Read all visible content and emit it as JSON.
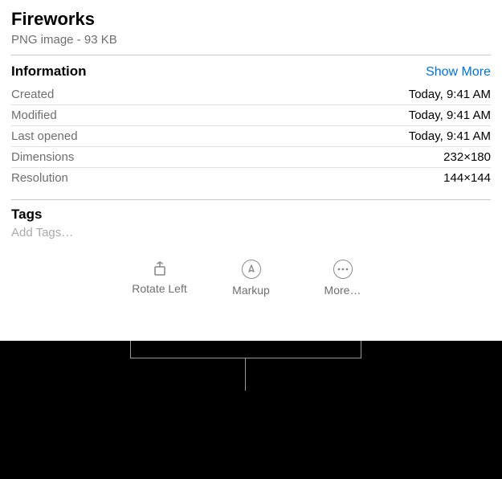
{
  "header": {
    "title": "Fireworks",
    "subtitle": "PNG image - 93 KB"
  },
  "information": {
    "heading": "Information",
    "show_more": "Show More",
    "rows": [
      {
        "label": "Created",
        "value": "Today, 9:41 AM"
      },
      {
        "label": "Modified",
        "value": "Today, 9:41 AM"
      },
      {
        "label": "Last opened",
        "value": "Today, 9:41 AM"
      },
      {
        "label": "Dimensions",
        "value": "232×180"
      },
      {
        "label": "Resolution",
        "value": "144×144"
      }
    ]
  },
  "tags": {
    "heading": "Tags",
    "placeholder": "Add Tags…"
  },
  "actions": {
    "rotate_left": "Rotate Left",
    "markup": "Markup",
    "more": "More…"
  }
}
